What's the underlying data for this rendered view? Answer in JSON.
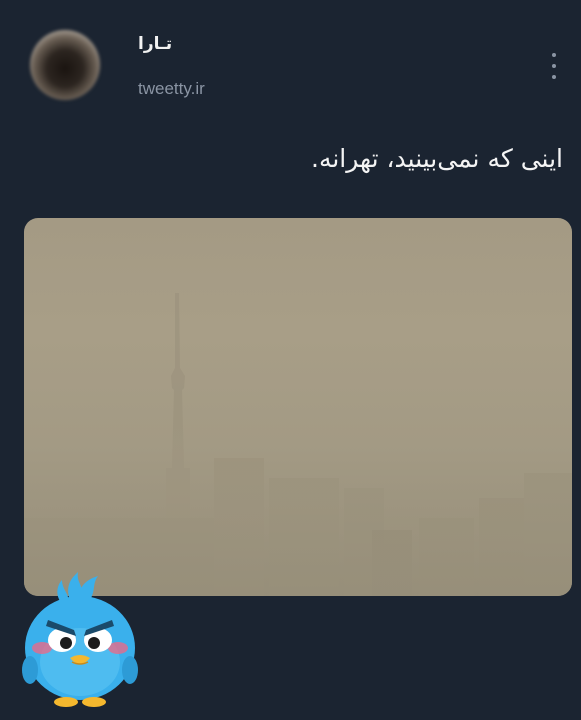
{
  "author": {
    "name": "تـارا",
    "handle": "tweetty.ir"
  },
  "menu": {
    "icon": "more-vertical-icon"
  },
  "tweet": {
    "text": "اینی که نمی‌بینید، تهرانه."
  },
  "media": {
    "description_icon": "photo",
    "colors": {
      "haze": "#a49a84",
      "skyline": "#8f8874"
    }
  },
  "mascot": {
    "icon": "angry-blue-bird-mascot-icon",
    "color": "#3ab0ec"
  },
  "theme": {
    "background": "#1b2431",
    "text": "#f4f4f4",
    "muted": "#8a94a3"
  }
}
